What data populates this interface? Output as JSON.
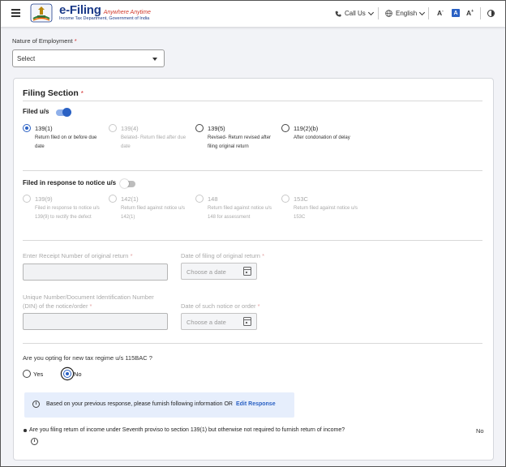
{
  "header": {
    "brand_name": "e-Filing",
    "brand_tagline": "Anywhere Anytime",
    "brand_subtitle": "Income Tax Department, Government of India",
    "call_us": "Call Us",
    "language": "English",
    "font_decrease": "A",
    "font_normal": "A",
    "font_increase": "A",
    "font_minus": "-",
    "font_plus": "+"
  },
  "employment": {
    "label": "Nature of Employment",
    "required_mark": "*",
    "selected": "Select"
  },
  "filing_section": {
    "title": "Filing Section",
    "required_mark": "*",
    "filed_us_label": "Filed u/s",
    "filed_us_toggle_on": true,
    "filed_us_options": [
      {
        "code": "139(1)",
        "desc": "Return filed on or before due date",
        "checked": true,
        "disabled": false
      },
      {
        "code": "139(4)",
        "desc": "Belated- Return filed after due date",
        "checked": false,
        "disabled": true
      },
      {
        "code": "139(5)",
        "desc": "Revised- Return revised after filing original return",
        "checked": false,
        "disabled": false
      },
      {
        "code": "119(2)(b)",
        "desc": "After condonation of delay",
        "checked": false,
        "disabled": false
      }
    ],
    "notice_label": "Filed in response to notice u/s",
    "notice_toggle_on": false,
    "notice_options": [
      {
        "code": "139(9)",
        "desc": "Filed in response to notice u/s 139(9) to rectify the defect"
      },
      {
        "code": "142(1)",
        "desc": "Return filed against notice u/s 142(1)"
      },
      {
        "code": "148",
        "desc": "Return filed against notice u/s 148 for assessment"
      },
      {
        "code": "153C",
        "desc": "Return filed against notice u/s 153C"
      }
    ],
    "receipt_label": "Enter Receipt Number of original return",
    "date_original_label": "Date of filing of original return",
    "din_label_line1": "Unique Number/Document Identification Number",
    "din_label_line2": "(DIN) of the notice/order",
    "date_notice_label": "Date of such notice or order",
    "date_placeholder": "Choose a date",
    "regime_question": "Are you opting for new tax regime u/s 115BAC ?",
    "regime_options": [
      {
        "label": "Yes",
        "checked": false
      },
      {
        "label": "No",
        "checked": true
      }
    ],
    "info_text": "Based on your previous response, please furnish following information OR",
    "edit_link": "Edit Response",
    "seventh_proviso_question": "Are you filing return of income under Seventh proviso to section 139(1) but otherwise not required to furnish return of income?",
    "seventh_proviso_answer": "No"
  },
  "colors": {
    "accent": "#2a61c4",
    "brand": "#1b3a88",
    "info_bg": "#e6eefc"
  }
}
